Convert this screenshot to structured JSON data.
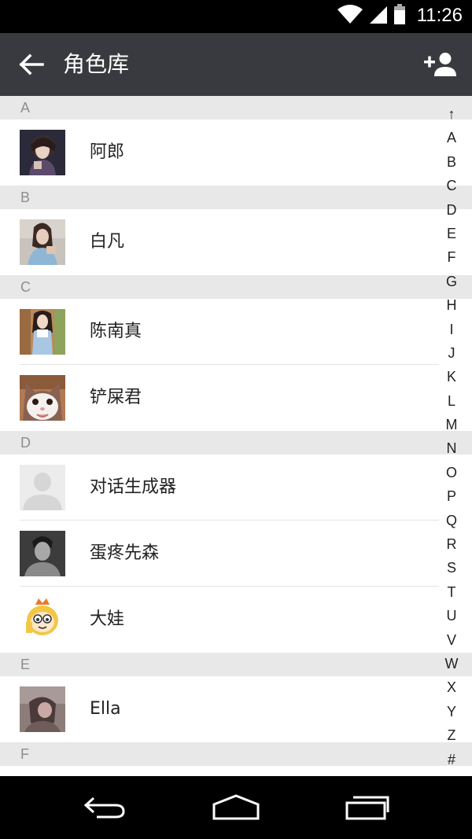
{
  "status_bar": {
    "time": "11:26",
    "wifi_icon": "wifi-icon",
    "signal_icon": "signal-icon",
    "battery_icon": "battery-icon"
  },
  "app_bar": {
    "title": "角色库",
    "back_icon": "back-arrow-icon",
    "add_icon": "add-person-icon"
  },
  "sections": [
    {
      "letter": "A",
      "items": [
        {
          "name": "阿郎",
          "avatar": "anime-boy"
        }
      ]
    },
    {
      "letter": "B",
      "items": [
        {
          "name": "白凡",
          "avatar": "girl-photo"
        }
      ]
    },
    {
      "letter": "C",
      "items": [
        {
          "name": "陈南真",
          "avatar": "girl-denim"
        },
        {
          "name": "铲屎君",
          "avatar": "cat"
        }
      ]
    },
    {
      "letter": "D",
      "items": [
        {
          "name": "对话生成器",
          "avatar": "default-person"
        },
        {
          "name": "蛋疼先森",
          "avatar": "man-bw"
        },
        {
          "name": "大娃",
          "avatar": "cartoon"
        }
      ]
    },
    {
      "letter": "E",
      "items": [
        {
          "name": "Ella",
          "avatar": "ella"
        }
      ]
    },
    {
      "letter": "F",
      "items": []
    }
  ],
  "index_letters": [
    "↑",
    "A",
    "B",
    "C",
    "D",
    "E",
    "F",
    "G",
    "H",
    "I",
    "J",
    "K",
    "L",
    "M",
    "N",
    "O",
    "P",
    "Q",
    "R",
    "S",
    "T",
    "U",
    "V",
    "W",
    "X",
    "Y",
    "Z",
    "#"
  ],
  "nav_bar": {
    "back_icon": "nav-back-icon",
    "home_icon": "nav-home-icon",
    "recents_icon": "nav-recents-icon"
  },
  "colors": {
    "app_bar": "#393a3f",
    "section_header": "#e8e8e8",
    "section_letter": "#8e8e8e",
    "name_text": "#222222"
  }
}
